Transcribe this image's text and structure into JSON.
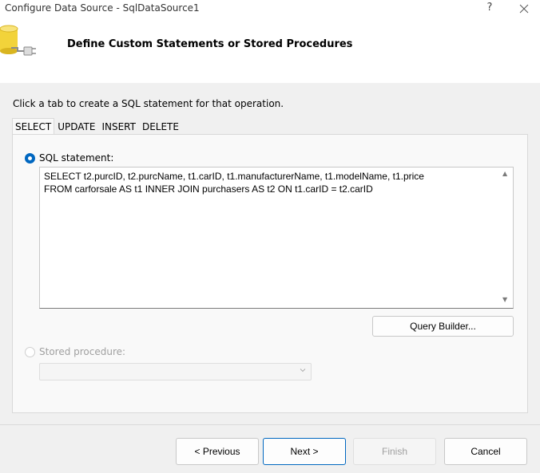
{
  "window": {
    "title": "Configure Data Source - SqlDataSource1",
    "help_label": "?",
    "heading": "Define Custom Statements or Stored Procedures"
  },
  "instruction": "Click a tab to create a SQL statement for that operation.",
  "tabs": [
    {
      "label": "SELECT",
      "active": true
    },
    {
      "label": "UPDATE",
      "active": false
    },
    {
      "label": "INSERT",
      "active": false
    },
    {
      "label": "DELETE",
      "active": false
    }
  ],
  "sql_option": {
    "label": "SQL statement:",
    "selected": true,
    "statement_line1": "SELECT t2.purcID, t2.purcName, t1.carID, t1.manufacturerName, t1.modelName, t1.price",
    "statement_line2": "FROM carforsale AS t1 INNER JOIN purchasers AS t2 ON t1.carID = t2.carID"
  },
  "query_builder_label": "Query Builder...",
  "stored_procedure": {
    "label": "Stored procedure:",
    "selected": false,
    "enabled": false,
    "value": ""
  },
  "footer": {
    "previous_label": "< Previous",
    "next_label": "Next >",
    "finish_label": "Finish",
    "cancel_label": "Cancel"
  },
  "colors": {
    "accent": "#0067c0",
    "header_bg": "#ffffff",
    "body_bg": "#f0f0f0"
  }
}
